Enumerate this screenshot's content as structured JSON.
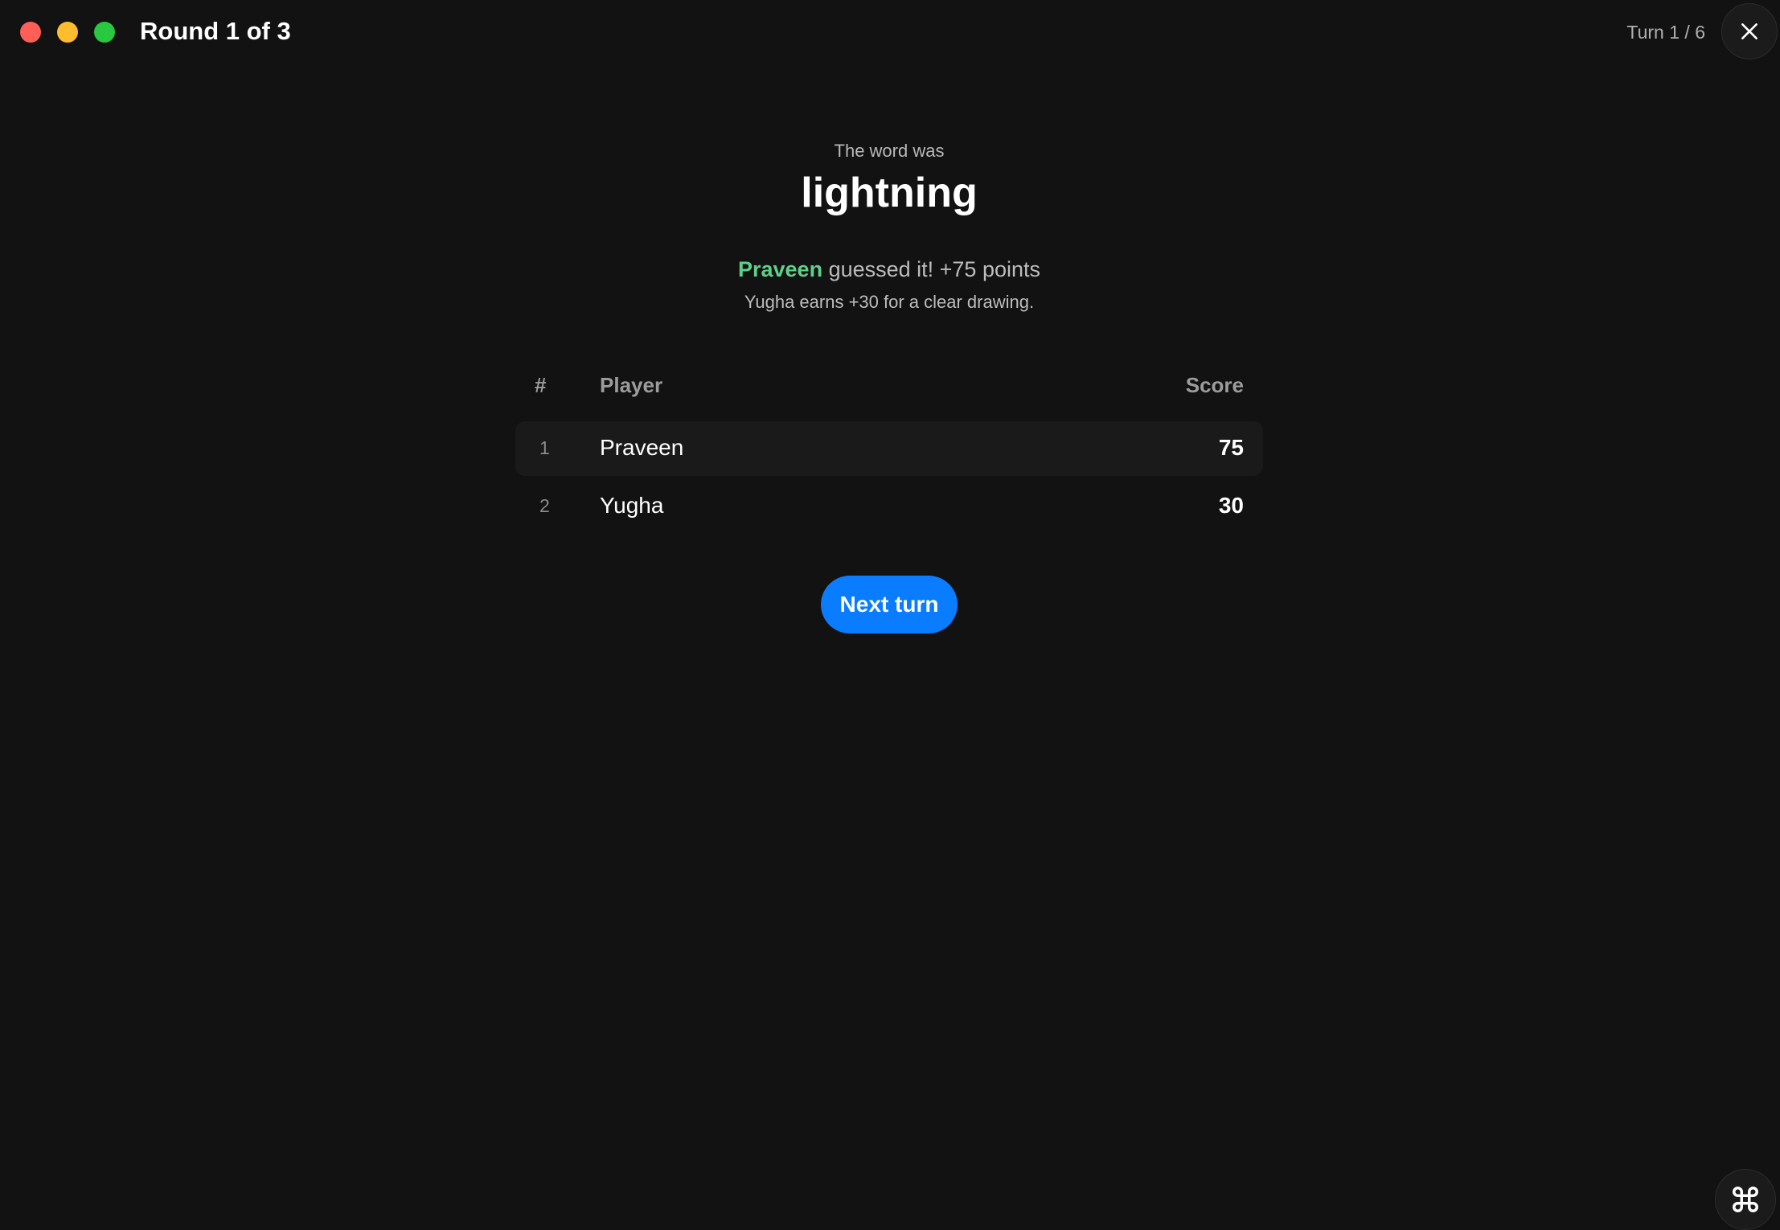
{
  "window": {
    "title": "Round 1 of 3",
    "turn_indicator": "Turn 1 / 6"
  },
  "reveal": {
    "label": "The word was",
    "word": "lightning",
    "guesser": "Praveen",
    "guess_text": " guessed it! +75 points",
    "bonus_text": "Yugha earns +30 for a clear drawing."
  },
  "scoreboard": {
    "headers": {
      "rank": "#",
      "player": "Player",
      "score": "Score"
    },
    "rows": [
      {
        "rank": "1",
        "player": "Praveen",
        "score": "75"
      },
      {
        "rank": "2",
        "player": "Yugha",
        "score": "30"
      }
    ]
  },
  "actions": {
    "next_turn_label": "Next turn"
  },
  "icons": {
    "close": "close-icon",
    "corner": "command-icon"
  },
  "colors": {
    "accent": "#0a7cff",
    "guesser": "#5fd08a",
    "background": "#121212"
  }
}
